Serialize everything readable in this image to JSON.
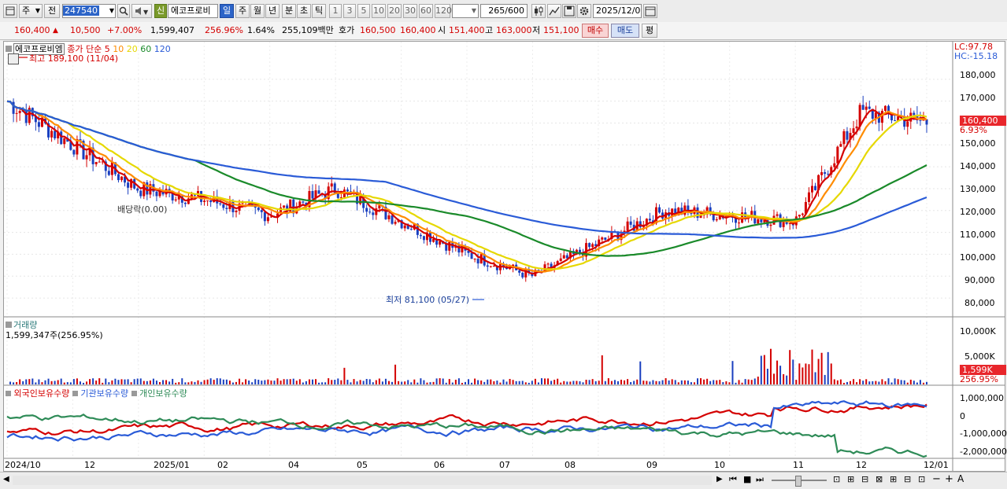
{
  "toolbar": {
    "period_label": "주",
    "prev_label": "전",
    "code": "247540",
    "new_badge": "신",
    "name": "에코프로비",
    "tf_day": "일",
    "tf_week": "주",
    "tf_month": "월",
    "tf_year": "년",
    "tf_min": "분",
    "tf_sec": "초",
    "tf_tick": "틱",
    "nums": [
      "1",
      "3",
      "5",
      "10",
      "20",
      "30",
      "60",
      "120"
    ],
    "count": "265",
    "count_total": "/600",
    "date": "2025/12/01",
    "icons": [
      "window-icon",
      "magnify-icon",
      "speaker-icon",
      "candle-icon",
      "chart-tool-icon",
      "save-icon",
      "gear-icon",
      "calendar-icon"
    ]
  },
  "quote": {
    "price": "160,400",
    "change": "10,500",
    "rate": "+7.00%",
    "volume": "1,599,407",
    "vol_rate": "256.96%",
    "turnover": "1.64%",
    "amount": "255,109백만",
    "ask_label": "호가",
    "ask": "160,500",
    "bid": "160,400",
    "open_label": "시",
    "open": "151,400",
    "high_label": "고",
    "high": "163,000",
    "low_label": "저",
    "low": "151,100",
    "buy": "매수",
    "sell": "매도",
    "avg": "평"
  },
  "price_panel": {
    "title": "에코프로비엠",
    "ma_label": "종가 단순",
    "ma_periods": [
      {
        "p": "5",
        "color": "#d40000"
      },
      {
        "p": "10",
        "color": "#ff8c00"
      },
      {
        "p": "20",
        "color": "#e6d800"
      },
      {
        "p": "60",
        "color": "#1a8a2a"
      },
      {
        "p": "120",
        "color": "#2a5bd7"
      }
    ],
    "lc": "LC:97.78",
    "hc": "HC:-15.18",
    "high_note": "최고 189,100 (11/04)",
    "low_note": "최저 81,100 (05/27)",
    "lock_note": "배당락(0.00)",
    "last_price": "160,400",
    "last_rate": "6.93%",
    "y_ticks": [
      "180,000",
      "170,000",
      "160,000",
      "150,000",
      "140,000",
      "130,000",
      "120,000",
      "110,000",
      "100,000",
      "90,000",
      "80,000"
    ]
  },
  "volume_panel": {
    "title": "거래량",
    "value": "1,599,347주(256.95%)",
    "y_ticks": [
      "10,000K",
      "5,000K"
    ],
    "last": "1,599K",
    "last_rate": "256.95%"
  },
  "holdings_panel": {
    "series": [
      {
        "name": "외국인보유수량",
        "color": "#d40000"
      },
      {
        "name": "기관보유수량",
        "color": "#2a5bd7"
      },
      {
        "name": "개인보유수량",
        "color": "#2e8b57"
      }
    ],
    "y_ticks": [
      "1,000,000",
      "0",
      "-1,000,000",
      "-2,000,000"
    ]
  },
  "x_axis": {
    "labels": [
      "2024/10",
      "12",
      "2025/01",
      "02",
      "03",
      "04",
      "05",
      "06",
      "07",
      "08",
      "09",
      "10",
      "11",
      "12",
      "12/01"
    ]
  },
  "chart_data": {
    "type": "line",
    "title": "에코프로비엠",
    "x": [
      "2024/10",
      "11",
      "12",
      "2025/01",
      "02",
      "03",
      "04",
      "05",
      "06",
      "07",
      "08",
      "09",
      "10",
      "11",
      "12"
    ],
    "series": [
      {
        "name": "종가",
        "values": [
          170000,
          150000,
          130000,
          125000,
          118000,
          130000,
          115000,
          100000,
          90000,
          105000,
          120000,
          118000,
          115000,
          165000,
          160400
        ]
      },
      {
        "name": "120",
        "values": [
          185000,
          178000,
          170000,
          164000,
          158000,
          150000,
          140000,
          125000,
          112000,
          106000,
          105000,
          105000,
          107000,
          115000,
          124000
        ]
      }
    ],
    "ylim": [
      75000,
      190000
    ],
    "annotations": [
      "최고 189,100 (11/04)",
      "최저 81,100 (05/27)",
      "배당락(0.00)"
    ]
  }
}
